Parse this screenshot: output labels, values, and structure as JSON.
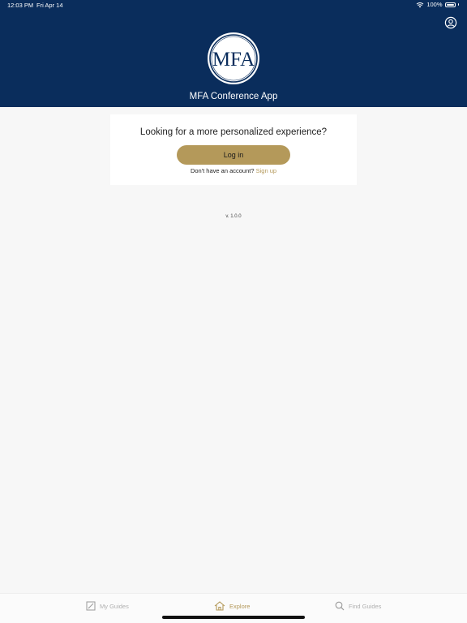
{
  "status_bar": {
    "time": "12:03 PM",
    "date": "Fri Apr 14",
    "battery": "100%",
    "battery_level": 1.0,
    "icons": [
      "wifi-icon",
      "battery-icon"
    ]
  },
  "header": {
    "logo_text": "MFA",
    "title": "MFA Conference App",
    "profile_icon": "user-circle-icon"
  },
  "login_card": {
    "heading": "Looking for a more personalized experience?",
    "login_label": "Log in",
    "no_account_text": "Don't have an account?",
    "signup_label": "Sign up"
  },
  "version": "v. 1.0.0",
  "tabs": [
    {
      "label": "My Guides",
      "icon": "guide-book-icon",
      "active": false
    },
    {
      "label": "Explore",
      "icon": "home-icon",
      "active": true
    },
    {
      "label": "Find Guides",
      "icon": "search-icon",
      "active": false
    }
  ],
  "colors": {
    "header_bg": "#0a2d5c",
    "accent_gold": "#b4995a",
    "page_bg": "#f7f7f7",
    "inactive_tab": "#b0b0b0"
  }
}
